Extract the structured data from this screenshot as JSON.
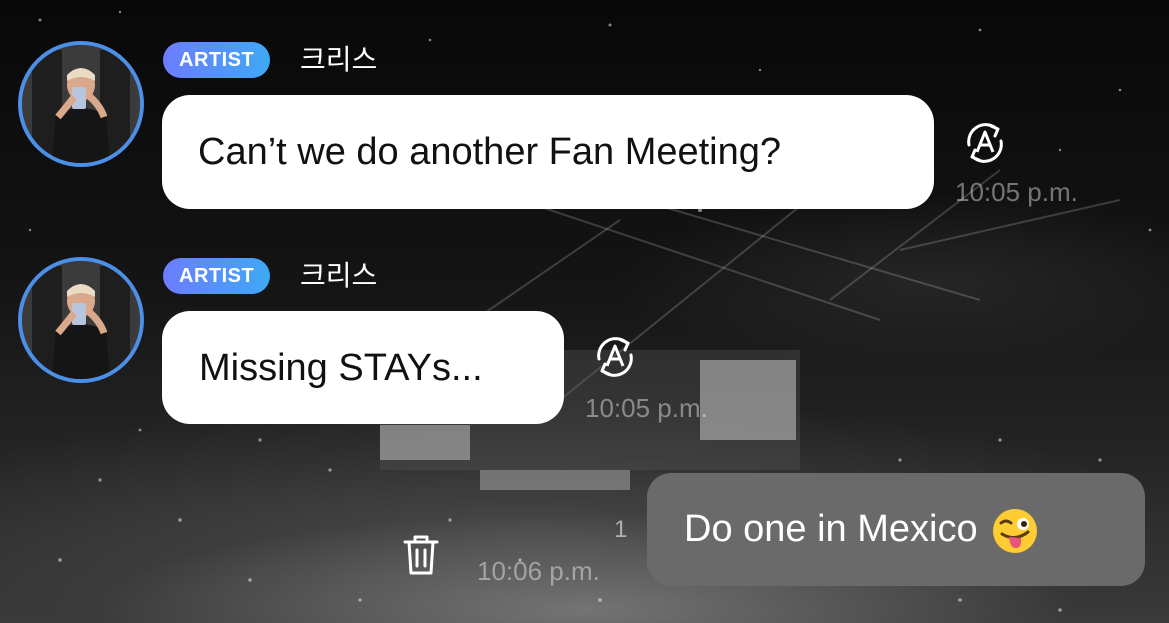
{
  "messages": [
    {
      "badge": "ARTIST",
      "sender": "크리스",
      "text": "Can’t we do another Fan Meeting?",
      "time": "10:05 p.m.",
      "translate_icon": "translate-icon"
    },
    {
      "badge": "ARTIST",
      "sender": "크리스",
      "text": "Missing STAYs...",
      "time": "10:05 p.m.",
      "translate_icon": "translate-icon"
    }
  ],
  "outgoing": {
    "text": "Do one in Mexico",
    "emoji": "winking-face-with-tongue-emoji",
    "read_count": "1",
    "time": "10:06 p.m.",
    "delete_icon": "trash-icon"
  },
  "colors": {
    "avatar_ring": "#4c8fe6",
    "badge_gradient_start": "#6c7dff",
    "badge_gradient_end": "#3ea9f4",
    "incoming_bubble": "#ffffff",
    "outgoing_bubble": "#6a6a6a"
  }
}
